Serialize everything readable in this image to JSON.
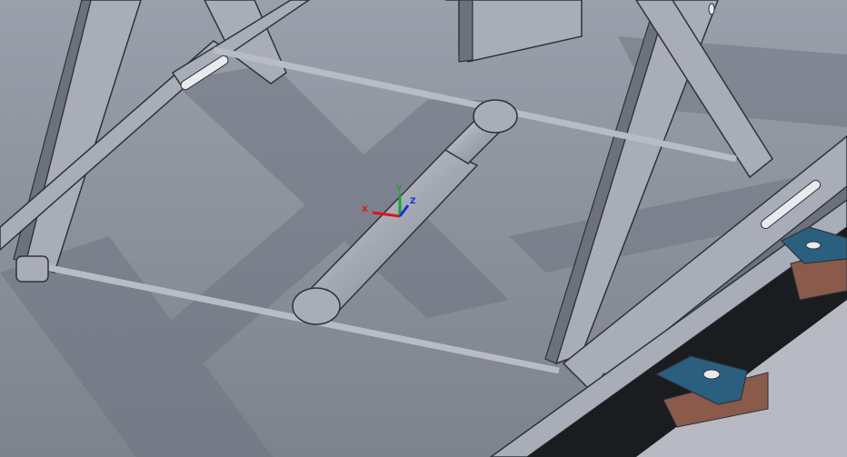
{
  "viewport": {
    "background_top": "#9aa0ab",
    "background_bottom": "#7d828d"
  },
  "model": {
    "frame_color": "#a9adb8",
    "frame_edge_color": "#2e323a",
    "plate_color": "#8c919c",
    "shadow_color": "#6f7481",
    "rod_color": "#b8bcc5",
    "bracket_color": "#2b5f7f",
    "pad_color": "#8a5a4a",
    "slot_color": "#e8eaee"
  },
  "triad": {
    "x_label": "X",
    "y_label": "Y",
    "z_label": "Z",
    "x_color": "#e0141c",
    "y_color": "#17a52a",
    "z_color": "#1a2fd6"
  }
}
